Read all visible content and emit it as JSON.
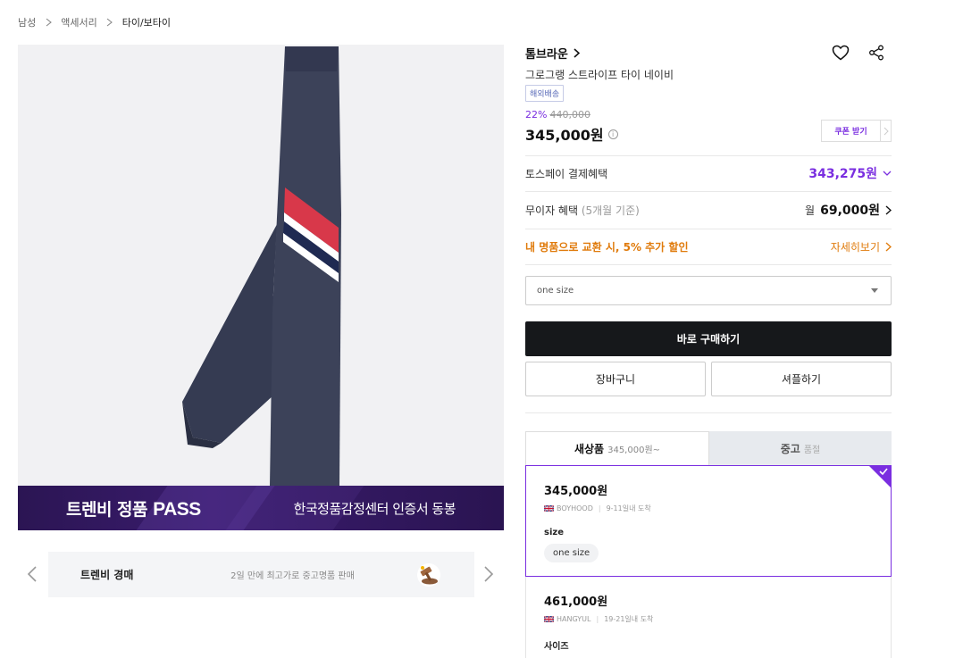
{
  "breadcrumb": [
    "남성",
    "액세서리",
    "타이/보타이"
  ],
  "banner": {
    "left_prefix": "트렌비 정품 ",
    "left_pass": "PASS",
    "right": "한국정품감정센터 인증서 동봉"
  },
  "auction": {
    "title": "트렌비 경매",
    "desc": "2일 만에 최고가로 중고명품 판매"
  },
  "product": {
    "brand": "톰브라운",
    "name": "그로그랭 스트라이프 타이 네이비",
    "shipping_badge": "해외배송",
    "discount_pct": "22%",
    "original_price": "440,000",
    "price": "345,000원",
    "coupon_label": "쿠폰 받기"
  },
  "benefits": {
    "toss_label": "토스페이 결제혜택",
    "toss_value": "343,275원",
    "interest_label": "무이자 혜택",
    "interest_sub": " (5개월 기준)",
    "interest_prefix": "월",
    "interest_value": "69,000원",
    "trade_label": "내 명품으로 교환 시, 5% 추가 할인",
    "trade_link": "자세히보기"
  },
  "size_select": {
    "value": "one size"
  },
  "buttons": {
    "buy_now": "바로 구매하기",
    "cart": "장바구니",
    "showroom": "셔플하기"
  },
  "tabs": [
    {
      "label": "새상품",
      "sub": "345,000원~"
    },
    {
      "label": "중고",
      "sub": "품절"
    }
  ],
  "offers": [
    {
      "price": "345,000원",
      "seller": "BOYHOOD",
      "arrival": "9-11일내 도착",
      "size_label": "size",
      "size": "one size"
    },
    {
      "price": "461,000원",
      "seller": "HANGYUL",
      "arrival": "19-21일내 도착",
      "size_label": "사이즈",
      "size": ""
    }
  ],
  "colors": {
    "accent": "#7a2ee0",
    "orange": "#e07b0c",
    "buy_button": "#16181b",
    "banner": "#2b1553"
  },
  "icons": [
    "chevron-right-icon",
    "heart-icon",
    "share-icon",
    "info-icon",
    "chevron-down-icon",
    "caret-down-icon",
    "chevron-left-icon",
    "check-icon",
    "uk-flag-icon",
    "gavel-icon"
  ]
}
